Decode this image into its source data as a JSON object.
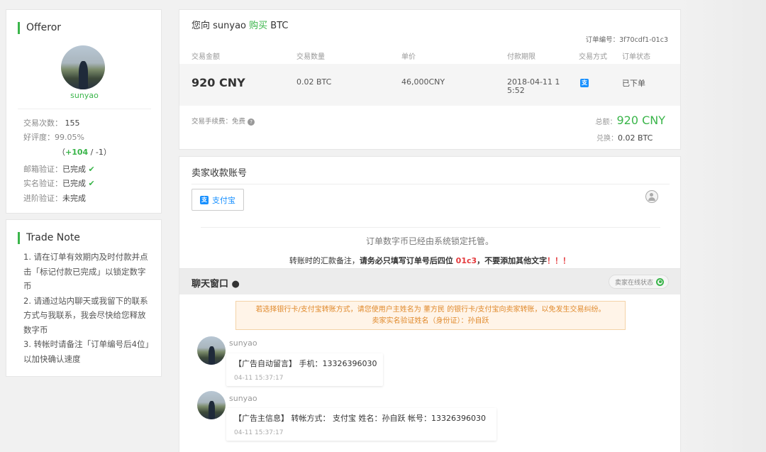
{
  "offeror": {
    "title": "Offeror",
    "name": "sunyao",
    "trade_count_label": "交易次数：",
    "trade_count": "155",
    "rating_label": "好评度：99.05%",
    "feedback_open": "（",
    "feedback_pos": "+104",
    "feedback_sep": " / ",
    "feedback_neg": "-1",
    "feedback_close": "）",
    "email_label": "邮箱验证：",
    "email_status": "已完成",
    "realname_label": "实名验证：",
    "realname_status": "已完成",
    "advanced_label": "进阶验证：",
    "advanced_status": "未完成"
  },
  "trade_note": {
    "title": "Trade Note",
    "lines": [
      "1. 请在订单有效期内及时付款并点击「标记付款已完成」以锁定数字币",
      "2. 请通过站内聊天或我留下的联系方式与我联系，我会尽快给您释放数字币",
      "3. 转帐时请备注「订单编号后4位」以加快确认速度"
    ]
  },
  "order": {
    "title_prefix": "您向 sunyao ",
    "title_action": "购买",
    "title_suffix": " BTC",
    "order_no": "订单编号：3f70cdf1-01c3",
    "headers": [
      "交易金额",
      "交易数量",
      "单价",
      "付款期限",
      "交易方式",
      "订单状态"
    ],
    "amount": "920 CNY",
    "quantity": "0.02 BTC",
    "price": "46,000CNY",
    "deadline": "2018-04-11 15:52",
    "method_icon": "支",
    "status": "已下单",
    "fee": "交易手续费：免费",
    "total_label": "总额：",
    "total_value": "920 CNY",
    "convert_label": "兑换：",
    "convert_value": "0.02 BTC"
  },
  "seller": {
    "title": "卖家收款账号",
    "pay_method": "支付宝",
    "escrow_text": "订单数字币已经由系统锁定托管。",
    "remark_prefix": "转账时的汇款备注，",
    "remark_bold": "请务必只填写订单号后四位 ",
    "remark_code": "01c3",
    "remark_bold2": "，不要添加其他文字",
    "remark_excl": "！！！"
  },
  "chat": {
    "title": "聊天窗口",
    "online_status": "卖家在线状态",
    "warning_line1": "若选择银行卡/支付宝转账方式，请您使用户主姓名为 董方民 的银行卡/支付宝向卖家转账，以免发生交易纠纷。",
    "warning_line2": "卖家实名验证姓名（身份证）：孙自跃",
    "messages": [
      {
        "user": "sunyao",
        "text": "【广告自动留言】 手机：13326396030",
        "time": "04-11 15:37:17"
      },
      {
        "user": "sunyao",
        "text": "【广告主信息】 转帐方式： 支付宝 姓名：孙自跃 帐号：13326396030",
        "time": "04-11 15:37:17"
      }
    ]
  }
}
